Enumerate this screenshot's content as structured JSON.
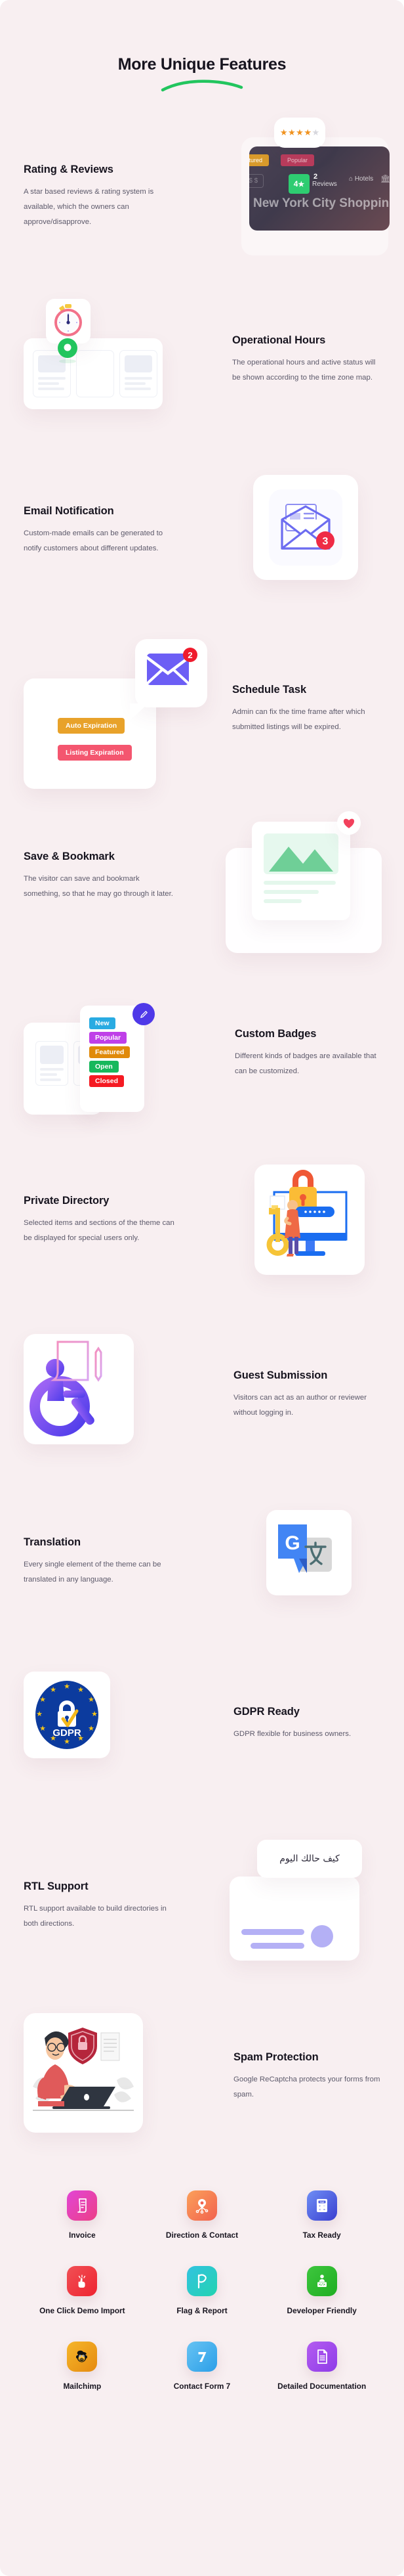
{
  "header": {
    "title": "More Unique Features",
    "underline_color": "#22c55e"
  },
  "features": [
    {
      "id": "rating-reviews",
      "title": "Rating & Reviews",
      "desc": "A star based reviews & rating system is available, which the owners can approve/disapprove.",
      "art_side": "right",
      "art": {
        "type": "listing-card",
        "stars": "★★★★",
        "half_star": "★",
        "star_color": "#f0921e",
        "rating_value": "4",
        "reviews_count": "2",
        "reviews_label": "Reviews",
        "badge_featured": "Featured",
        "badge_popular": "Popular",
        "price": "$ $ $",
        "category": "Hotels",
        "caption": "New York City Shopping"
      }
    },
    {
      "id": "operational-hours",
      "title": "Operational Hours",
      "desc": "The operational hours and active status will be shown according to the time zone map.",
      "art_side": "left",
      "art": {
        "type": "stopwatch-map",
        "pin_color": "#22c55e",
        "clock_color": "#f2728a"
      }
    },
    {
      "id": "email-notification",
      "title": "Email Notification",
      "desc": "Custom-made emails can be generated to notify customers about different updates.",
      "art_side": "right",
      "art": {
        "type": "open-envelope",
        "badge": "3",
        "badge_color": "#ef2b45",
        "envelope_color": "#6c6cf0"
      }
    },
    {
      "id": "schedule-task",
      "title": "Schedule Task",
      "desc": "Admin can fix the time frame after which submitted listings will be expired.",
      "art_side": "left",
      "art": {
        "type": "expiration-tags",
        "badge": "2",
        "badge_color": "#ef1b2d",
        "envelope_color": "#6c5ef5",
        "tag1": "Auto Expiration",
        "tag1_color": "#e8a22a",
        "tag2": "Listing Expiration",
        "tag2_color": "#f4566f"
      }
    },
    {
      "id": "save-bookmark",
      "title": "Save & Bookmark",
      "desc": "The visitor can save and bookmark something, so that he may go through it later.",
      "art_side": "right",
      "art": {
        "type": "bookmark-card",
        "heart_color": "#f2415c",
        "image_color": "#6fcf97"
      }
    },
    {
      "id": "custom-badges",
      "title": "Custom Badges",
      "desc": "Different kinds of badges are available that can be customized.",
      "art_side": "left",
      "art": {
        "type": "badge-stack",
        "edit_color": "#4f39e8",
        "badges": [
          {
            "label": "New",
            "color": "#29abe2"
          },
          {
            "label": "Popular",
            "color": "#bf3fe8"
          },
          {
            "label": "Featured",
            "color": "#e08a0a"
          },
          {
            "label": "Open",
            "color": "#17b85c"
          },
          {
            "label": "Closed",
            "color": "#f51a22"
          }
        ]
      }
    },
    {
      "id": "private-directory",
      "title": "Private Directory",
      "desc": "Selected items and sections of the theme can be displayed for special users only.",
      "art_side": "right",
      "art": {
        "type": "lock-monitor",
        "lock_color": "#fbbc36",
        "shackle_color": "#ef5835",
        "screen_color": "#1a6df0",
        "key_color": "#f6c437"
      }
    },
    {
      "id": "guest-submission",
      "title": "Guest Submission",
      "desc": "Visitors can act as an author or reviewer without logging in.",
      "art_side": "left",
      "art": {
        "type": "guest-author",
        "person_color": "#7b4bf0",
        "doc_color": "#f48fbe"
      }
    },
    {
      "id": "translation",
      "title": "Translation",
      "desc": "Every single element of the theme can be translated in any language.",
      "art_side": "right",
      "art": {
        "type": "google-translate",
        "blue": "#4285f4",
        "grey": "#d8d8d8",
        "dark_blue": "#2c5cc5",
        "teal": "#4c6e72"
      }
    },
    {
      "id": "gdpr-ready",
      "title": "GDPR Ready",
      "desc": "GDPR flexible for business owners.",
      "art_side": "left",
      "art": {
        "type": "gdpr-badge",
        "label": "GDPR",
        "eu_blue": "#0c3b9e",
        "star_color": "#f5c518",
        "check_color": "#f5b91b"
      }
    },
    {
      "id": "rtl-support",
      "title": "RTL Support",
      "desc": "RTL support available to build directories in both directions.",
      "art_side": "right",
      "art": {
        "type": "rtl-card",
        "arabic_text": "كيف حالك اليوم",
        "bar_color": "#b4b0f5"
      }
    },
    {
      "id": "spam-protection",
      "title": "Spam Protection",
      "desc": "Google ReCaptcha protects your forms from spam.",
      "art_side": "left",
      "art": {
        "type": "spam-illustration",
        "shirt_color": "#e05a5a",
        "shield_color": "#b5253b",
        "laptop_color": "#2f3540"
      }
    }
  ],
  "grid": {
    "items": [
      {
        "label": "Invoice",
        "icon": "invoice-icon",
        "c1": "#e246d6",
        "c2": "#ec3f86"
      },
      {
        "label": "Direction & Contact",
        "icon": "location-pin-icon",
        "c1": "#fba05a",
        "c2": "#f2624e"
      },
      {
        "label": "Tax Ready",
        "icon": "calculator-icon",
        "c1": "#6f8ef5",
        "c2": "#3a3fd0"
      },
      {
        "label": "One Click Demo Import",
        "icon": "click-hand-icon",
        "c1": "#f05055",
        "c2": "#ef2330"
      },
      {
        "label": "Flag & Report",
        "icon": "flag-icon",
        "c1": "#33c3e0",
        "c2": "#22d3b0"
      },
      {
        "label": "Developer Friendly",
        "icon": "developer-icon",
        "c1": "#3ec63e",
        "c2": "#1fae22"
      },
      {
        "label": "Mailchimp",
        "icon": "mailchimp-monkey-icon",
        "c1": "#f6b62a",
        "c2": "#e58a10"
      },
      {
        "label": "Contact Form 7",
        "icon": "contact-form-7-icon",
        "c1": "#67c3f3",
        "c2": "#2b9fe8"
      },
      {
        "label": "Detailed Documentation",
        "icon": "document-icon",
        "c1": "#b45cf0",
        "c2": "#8e3ce8"
      }
    ]
  }
}
